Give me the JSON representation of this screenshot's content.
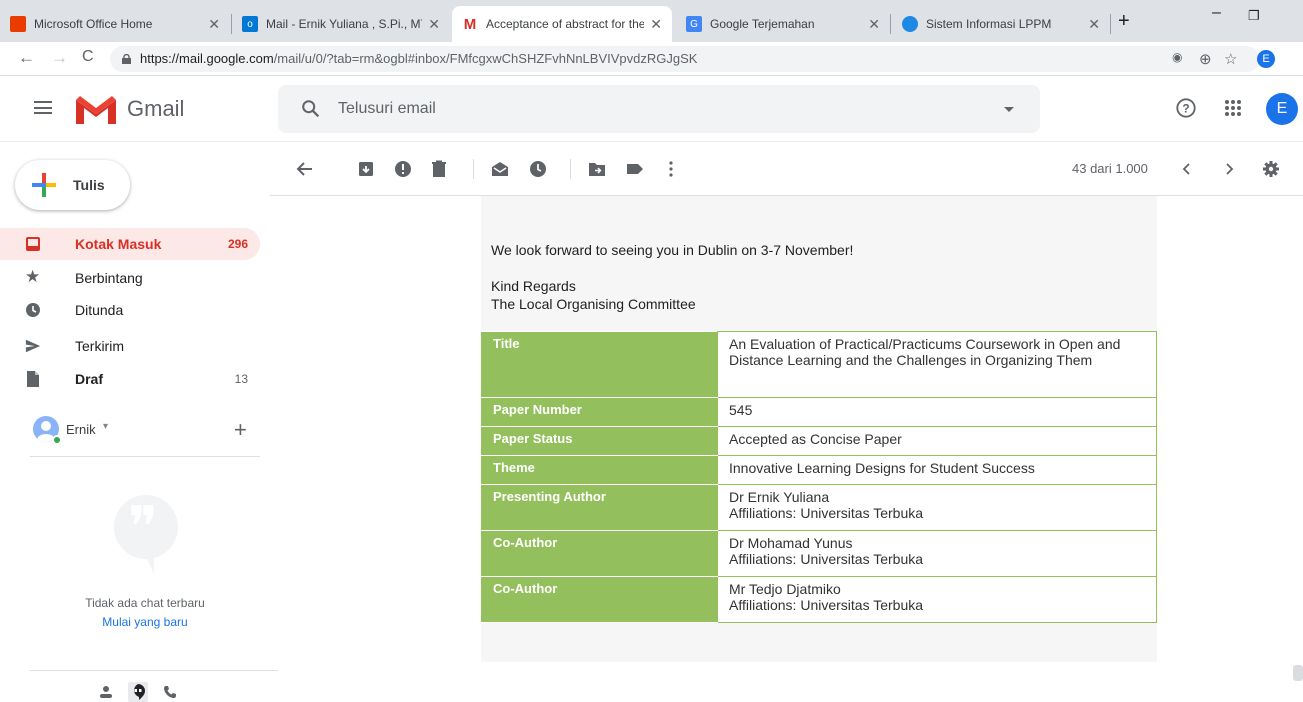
{
  "browser": {
    "tabs": [
      {
        "title": "Microsoft Office Home",
        "icon": "office-icon",
        "color": "#eb3c00"
      },
      {
        "title": "Mail - Ernik Yuliana , S.Pi., MT.",
        "icon": "outlook-icon",
        "color": "#0078d4"
      },
      {
        "title": "Acceptance of abstract for the",
        "icon": "gmail-icon",
        "color": "#d93025",
        "active": true
      },
      {
        "title": "Google Terjemahan",
        "icon": "translate-icon",
        "color": "#4285f4"
      },
      {
        "title": "Sistem Informasi LPPM",
        "icon": "globe-icon",
        "color": "#1e88e5"
      }
    ],
    "new_tab": "+",
    "url_domain": "https://mail.google.com",
    "url_path": "/mail/u/0/?tab=rm&ogbl#inbox/FMfcgxwChSHZFvhNnLBVIVpvdzRGJgSK",
    "profile_initial": "E"
  },
  "gmail": {
    "brand": "Gmail",
    "search_placeholder": "Telusuri email",
    "avatar_initial": "E",
    "compose_label": "Tulis",
    "nav": [
      {
        "label": "Kotak Masuk",
        "count": "296",
        "icon": "inbox-icon",
        "active": true
      },
      {
        "label": "Berbintang",
        "count": "",
        "icon": "star-icon"
      },
      {
        "label": "Ditunda",
        "count": "",
        "icon": "clock-icon"
      },
      {
        "label": "Terkirim",
        "count": "",
        "icon": "send-icon"
      },
      {
        "label": "Draf",
        "count": "13",
        "icon": "draft-icon",
        "bold": true
      }
    ],
    "hangouts_user": "Ernik",
    "no_chat": "Tidak ada chat terbaru",
    "new_chat": "Mulai yang baru",
    "pager": "43 dari 1.000"
  },
  "message": {
    "line1": "We look forward to seeing you in Dublin on 3-7 November!",
    "regards": "Kind Regards",
    "committee": "The Local Organising Committee",
    "table": [
      {
        "key": "Title",
        "value": "An Evaluation of Practical/Practicums Coursework in Open and Distance Learning and the Challenges in Organizing Them"
      },
      {
        "key": "Paper Number",
        "value": "545"
      },
      {
        "key": "Paper Status",
        "value": "Accepted as Concise Paper"
      },
      {
        "key": "Theme",
        "value": "Innovative Learning Designs for Student Success"
      },
      {
        "key": "Presenting Author",
        "value": "Dr Ernik Yuliana",
        "value2": "Affiliations: Universitas Terbuka"
      },
      {
        "key": "Co-Author",
        "value": "Dr Mohamad Yunus",
        "value2": "Affiliations: Universitas Terbuka"
      },
      {
        "key": "Co-Author",
        "value": "Mr Tedjo Djatmiko",
        "value2": "Affiliations: Universitas Terbuka"
      }
    ]
  },
  "colors": {
    "accent_green": "#93c05c",
    "gmail_red": "#d93025",
    "active_bg": "#fce8e6"
  }
}
